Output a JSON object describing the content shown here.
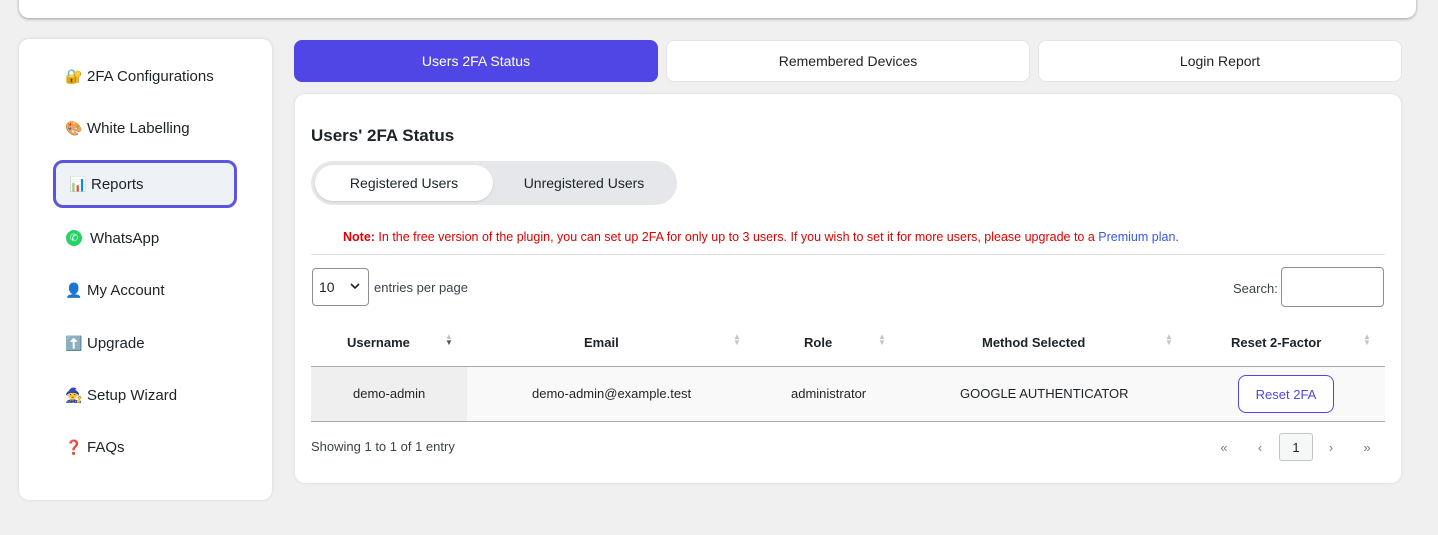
{
  "sidebar": {
    "items": [
      {
        "icon": "🔐",
        "label": "2FA Configurations"
      },
      {
        "icon": "🎨",
        "label": "White Labelling"
      },
      {
        "icon": "📊",
        "label": "Reports"
      },
      {
        "icon": "✆",
        "label": "WhatsApp"
      },
      {
        "icon": "👤",
        "label": "My Account"
      },
      {
        "icon": "⬆️",
        "label": "Upgrade"
      },
      {
        "icon": "🧙",
        "label": "Setup Wizard"
      },
      {
        "icon": "❓",
        "label": "FAQs"
      }
    ],
    "active": "Reports"
  },
  "tabs": [
    {
      "label": "Users 2FA Status"
    },
    {
      "label": "Remembered Devices"
    },
    {
      "label": "Login Report"
    }
  ],
  "panel": {
    "title": "Users' 2FA Status",
    "segments": [
      "Registered Users",
      "Unregistered Users"
    ],
    "note": {
      "prefix": "Note:",
      "text": " In the free version of the plugin, you can set up 2FA for only up to 3 users. If you wish to set it for more users, please upgrade to a ",
      "link": "Premium plan",
      "suffix": "."
    }
  },
  "table": {
    "length_value": "10",
    "length_label": "entries per page",
    "search_label": "Search:",
    "search_value": "",
    "columns": [
      "Username",
      "Email",
      "Role",
      "Method Selected",
      "Reset 2-Factor"
    ],
    "rows": [
      {
        "username": "demo-admin",
        "email": "demo-admin@example.test",
        "role": "administrator",
        "method": "GOOGLE AUTHENTICATOR",
        "action": "Reset 2FA"
      }
    ],
    "info": "Showing 1 to 1 of 1 entry",
    "pagination": {
      "first": "«",
      "prev": "‹",
      "current": "1",
      "next": "›",
      "last": "»"
    }
  },
  "colors": {
    "accent": "#5046e5",
    "note_red": "#e00000",
    "link_blue": "#3858e9",
    "whatsapp_green": "#25d366"
  }
}
